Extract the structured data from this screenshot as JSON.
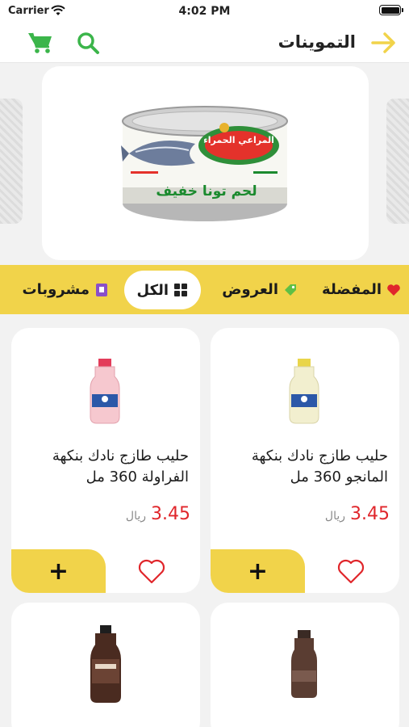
{
  "status_bar": {
    "carrier": "Carrier",
    "time": "4:02 PM"
  },
  "header": {
    "title": "التموينات",
    "back_icon": "arrow-right-icon",
    "search_icon": "search-icon",
    "cart_icon": "cart-icon"
  },
  "colors": {
    "accent_yellow": "#f1d34a",
    "icon_green": "#3bb54a",
    "price_red": "#e0262b",
    "heart_red": "#e0262b"
  },
  "banner": {
    "product_label_top": "المراعي الحمراء",
    "product_label_bottom": "لحم تونا خفيف"
  },
  "categories": [
    {
      "label": "المفضلة",
      "icon": "heart-icon",
      "active": false
    },
    {
      "label": "العروض",
      "icon": "tag-icon",
      "active": false
    },
    {
      "label": "الكل",
      "icon": "grid-icon",
      "active": true
    },
    {
      "label": "مشروبات",
      "icon": "drink-icon",
      "active": false
    }
  ],
  "products": [
    {
      "name": "حليب طازج نادك بنكهة المانجو 360 مل",
      "price": "3.45",
      "currency": "ريال",
      "add_label": "+"
    },
    {
      "name": "حليب طازج نادك بنكهة الفراولة 360 مل",
      "price": "3.45",
      "currency": "ريال",
      "add_label": "+"
    },
    {
      "name": "",
      "price": "",
      "currency": "",
      "add_label": ""
    },
    {
      "name": "",
      "price": "",
      "currency": "",
      "add_label": ""
    }
  ]
}
